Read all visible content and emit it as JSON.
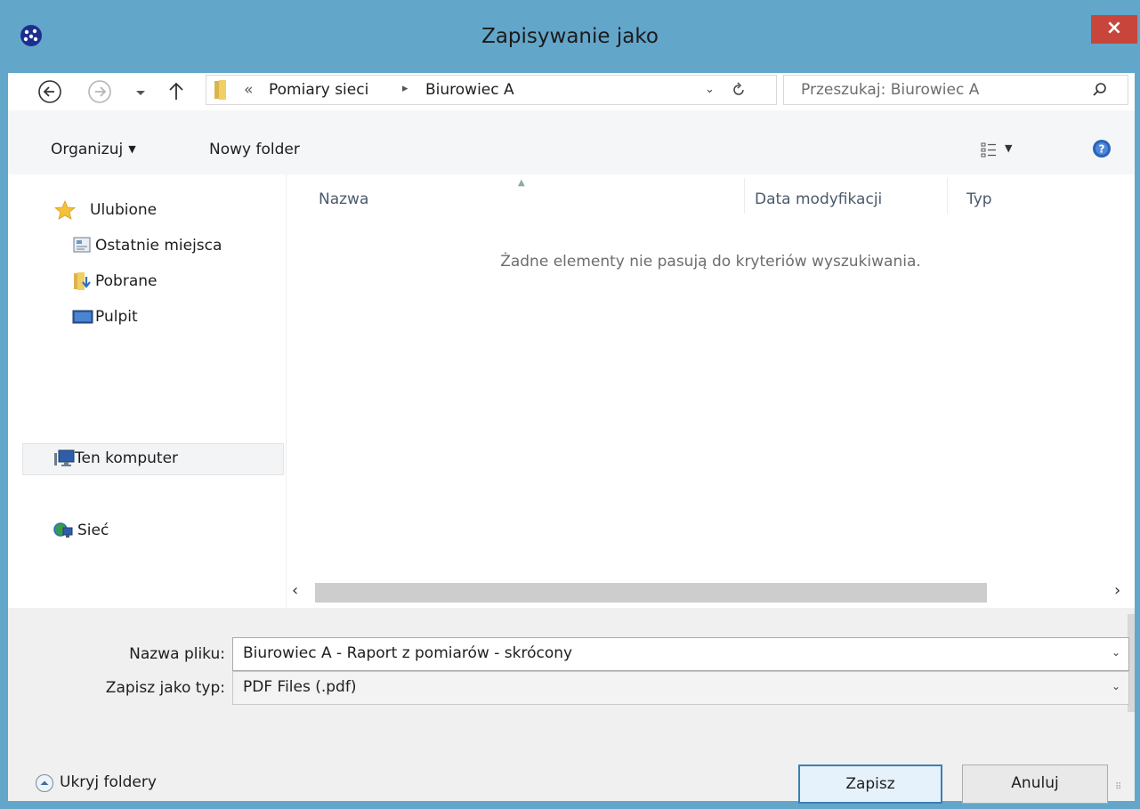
{
  "window": {
    "title": "Zapisywanie jako",
    "close_label": "×"
  },
  "nav": {
    "breadcrumb_prefix": "«",
    "breadcrumb": [
      "Pomiary sieci",
      "Biurowiec A"
    ],
    "search_placeholder": "Przeszukaj: Biurowiec A"
  },
  "toolbar": {
    "organize_label": "Organizuj",
    "new_folder_label": "Nowy folder"
  },
  "sidebar": {
    "items": [
      {
        "label": "Ulubione",
        "icon": "star-icon"
      },
      {
        "label": "Ostatnie miejsca",
        "icon": "recent-places-icon"
      },
      {
        "label": "Pobrane",
        "icon": "downloads-folder-icon"
      },
      {
        "label": "Pulpit",
        "icon": "desktop-icon"
      },
      {
        "label": "Ten komputer",
        "icon": "computer-icon"
      },
      {
        "label": "Sieć",
        "icon": "network-icon"
      }
    ]
  },
  "filelist": {
    "columns": [
      "Nazwa",
      "Data modyfikacji",
      "Typ"
    ],
    "empty_message": "Żadne elementy nie pasują do kryteriów wyszukiwania."
  },
  "form": {
    "filename_label": "Nazwa pliku:",
    "filename_value": "Biurowiec A - Raport z pomiarów - skrócony",
    "filetype_label": "Zapisz jako typ:",
    "filetype_value": "PDF Files (.pdf)"
  },
  "footer": {
    "hide_folders_label": "Ukryj foldery",
    "save_label": "Zapisz",
    "cancel_label": "Anuluj"
  },
  "colors": {
    "frame": "#62a6ca",
    "close_button": "#c7453b",
    "accent": "#3c7fb1"
  }
}
